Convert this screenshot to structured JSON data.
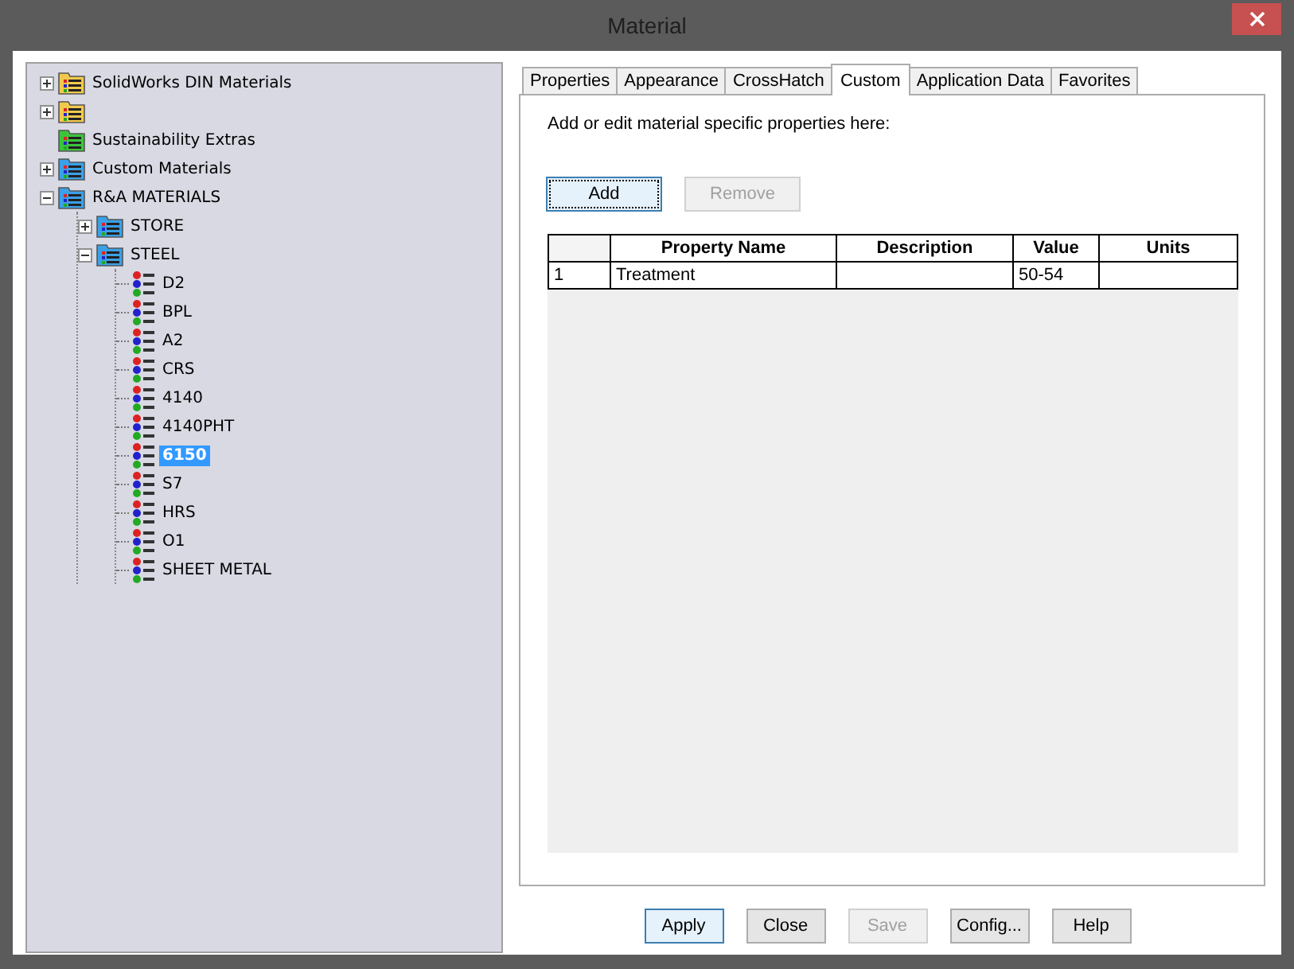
{
  "window": {
    "title": "Material"
  },
  "tree": [
    {
      "kind": "folder",
      "color": "#f2c94c",
      "label": "SolidWorks DIN Materials",
      "expanded": false
    },
    {
      "kind": "folder",
      "color": "#f2c94c",
      "expanded": false
    },
    {
      "kind": "folder",
      "color": "#3cc43c",
      "label": "Sustainability Extras"
    },
    {
      "kind": "folder",
      "color": "#3aa0e8",
      "label": "Custom Materials",
      "expanded": false
    },
    {
      "kind": "folder",
      "color": "#3aa0e8",
      "label": "R&A MATERIALS",
      "expanded": true,
      "children": [
        {
          "kind": "folder",
          "color": "#3aa0e8",
          "label": "STORE",
          "expanded": false
        },
        {
          "kind": "folder",
          "color": "#3aa0e8",
          "label": "STEEL",
          "expanded": true,
          "children": [
            {
              "kind": "material",
              "label": "D2",
              "selected": false
            },
            {
              "kind": "material",
              "label": "BPL",
              "selected": false
            },
            {
              "kind": "material",
              "label": "A2",
              "selected": false
            },
            {
              "kind": "material",
              "label": "CRS",
              "selected": false
            },
            {
              "kind": "material",
              "label": "4140",
              "selected": false
            },
            {
              "kind": "material",
              "label": "4140PHT",
              "selected": false
            },
            {
              "kind": "material",
              "label": "6150",
              "selected": true
            },
            {
              "kind": "material",
              "label": "S7",
              "selected": false
            },
            {
              "kind": "material",
              "label": "HRS",
              "selected": false
            },
            {
              "kind": "material",
              "label": "O1",
              "selected": false
            },
            {
              "kind": "material",
              "label": "SHEET METAL",
              "selected": false
            }
          ]
        }
      ]
    }
  ],
  "tabs": [
    {
      "label": "Properties",
      "selected": false
    },
    {
      "label": "Appearance",
      "selected": false
    },
    {
      "label": "CrossHatch",
      "selected": false
    },
    {
      "label": "Custom",
      "selected": true
    },
    {
      "label": "Application Data",
      "selected": false
    },
    {
      "label": "Favorites",
      "selected": false
    }
  ],
  "custom": {
    "instructions": "Add or edit material specific properties here:",
    "buttons": [
      {
        "label": "Add",
        "disabled": false,
        "focused": true
      },
      {
        "label": "Remove",
        "disabled": true,
        "focused": false
      }
    ],
    "table": {
      "columns": [
        "Property Name",
        "Description",
        "Value",
        "Units"
      ],
      "rows": [
        {
          "number": "1",
          "property_name": "Treatment",
          "value": "50-54"
        }
      ]
    }
  },
  "buttons": [
    {
      "label": "Apply",
      "disabled": false,
      "default": true
    },
    {
      "label": "Close",
      "disabled": false,
      "default": false
    },
    {
      "label": "Save",
      "disabled": true,
      "default": false
    },
    {
      "label": "Config...",
      "disabled": false,
      "default": false
    },
    {
      "label": "Help",
      "disabled": false,
      "default": false
    }
  ]
}
